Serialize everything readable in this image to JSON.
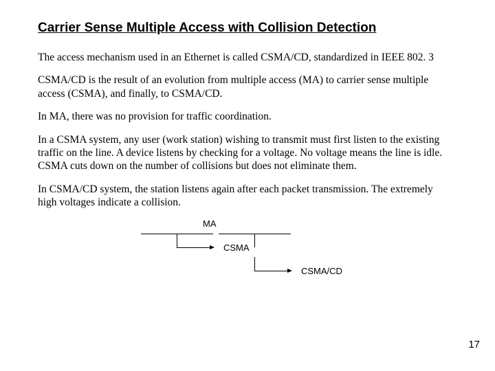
{
  "title": "Carrier Sense Multiple Access with Collision Detection",
  "paragraphs": {
    "p1": "The access mechanism used in an Ethernet is called CSMA/CD, standardized in IEEE 802. 3",
    "p2": "CSMA/CD is the result of an evolution from multiple access (MA) to carrier sense multiple access (CSMA), and finally, to CSMA/CD.",
    "p3": "In MA, there was no provision for traffic coordination.",
    "p4": "In a CSMA system, any user (work station) wishing to transmit must first listen to the existing traffic on the line. A device listens by checking for a voltage. No voltage means the line is idle. CSMA cuts down on the number of collisions but does not eliminate them.",
    "p5": "In CSMA/CD system, the station listens again after each packet transmission. The extremely high voltages indicate a collision."
  },
  "diagram": {
    "label1": "MA",
    "label2": "CSMA",
    "label3": "CSMA/CD"
  },
  "page_number": "17"
}
